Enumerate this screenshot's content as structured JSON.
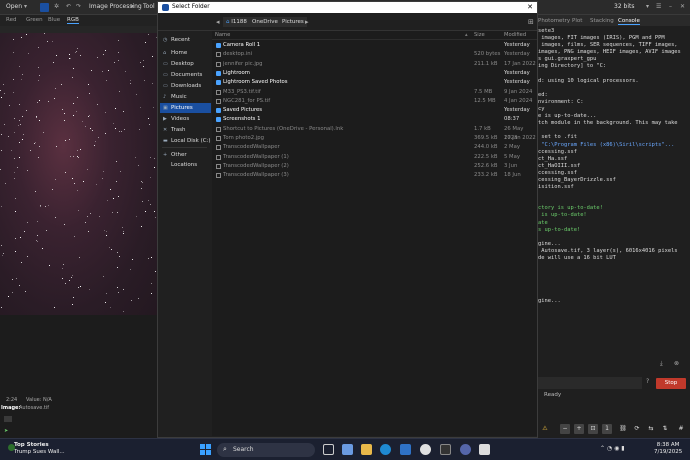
{
  "host": {
    "menu": {
      "open": "Open",
      "image_processing": "Image Processing",
      "tools": "Tool",
      "bits": "32 bits"
    },
    "channels": [
      "Red",
      "Green",
      "Blue",
      "RGB"
    ],
    "active_channel": "RGB",
    "image_label": "Image:",
    "image_name": "Autosave.tif",
    "coords": "2:24",
    "value": "Value: N/A",
    "right_tabs": [
      "Photometry",
      "Plot",
      "Stacking",
      "Console"
    ],
    "active_right_tab": "Console",
    "console_lines": [
      {
        "t": "sete3",
        "c": ""
      },
      {
        "t": " images, FIT images (IRIS), PGM and PPM",
        "c": ""
      },
      {
        "t": " images, films, SER sequences, TIFF images,",
        "c": ""
      },
      {
        "t": "images, PNG images, HEIF images, AVIF images",
        "c": ""
      },
      {
        "t": "s gui.graxpert_gpu",
        "c": ""
      },
      {
        "t": "ing Directory] to \"C:",
        "c": ""
      },
      {
        "t": "",
        "c": ""
      },
      {
        "t": "d: using 10 logical processors.",
        "c": ""
      },
      {
        "t": "",
        "c": ""
      },
      {
        "t": "ed:",
        "c": ""
      },
      {
        "t": "nvironment: C:",
        "c": ""
      },
      {
        "t": "cy",
        "c": ""
      },
      {
        "t": "e is up-to-date...",
        "c": ""
      },
      {
        "t": "tch module in the background. This may take",
        "c": ""
      },
      {
        "t": "",
        "c": ""
      },
      {
        "t": " set to .fit",
        "c": ""
      },
      {
        "t": " \"C:\\Program Files (x86)\\Siril\\scripts\"...",
        "c": "b"
      },
      {
        "t": "ccessing.ssf",
        "c": ""
      },
      {
        "t": "ct_Ha.ssf",
        "c": ""
      },
      {
        "t": "ct_HaOIII.ssf",
        "c": ""
      },
      {
        "t": "ccessing.ssf",
        "c": ""
      },
      {
        "t": "cessing_BayerDrizzle.ssf",
        "c": ""
      },
      {
        "t": "isition.ssf",
        "c": ""
      },
      {
        "t": "",
        "c": ""
      },
      {
        "t": "",
        "c": ""
      },
      {
        "t": "ctory is up-to-date!",
        "c": "g"
      },
      {
        "t": " is up-to-date!",
        "c": "g"
      },
      {
        "t": "ate",
        "c": "g"
      },
      {
        "t": "s up-to-date!",
        "c": "g"
      },
      {
        "t": "",
        "c": ""
      },
      {
        "t": "gine...",
        "c": ""
      },
      {
        "t": " Autosave.tif, 3 layer(s), 6016x4016 pixels",
        "c": ""
      },
      {
        "t": "de will use a 16 bit LUT",
        "c": ""
      },
      {
        "t": "",
        "c": ""
      },
      {
        "t": "",
        "c": ""
      },
      {
        "t": "",
        "c": ""
      },
      {
        "t": "",
        "c": ""
      },
      {
        "t": "",
        "c": ""
      },
      {
        "t": "gine...",
        "c": ""
      }
    ],
    "stop_label": "Stop",
    "status_text": "Ready"
  },
  "dialog": {
    "title": "Select Folder",
    "breadcrumb": [
      "I1188",
      "OneDrive",
      "Pictures"
    ],
    "sidebar": [
      {
        "label": "Recent",
        "icon": "clock-icon",
        "glyph": "◷"
      },
      {
        "label": "Home",
        "icon": "home-icon",
        "glyph": "⌂"
      },
      {
        "label": "Desktop",
        "icon": "folder-icon",
        "glyph": "▭"
      },
      {
        "label": "Documents",
        "icon": "folder-icon",
        "glyph": "▭"
      },
      {
        "label": "Downloads",
        "icon": "folder-icon",
        "glyph": "▭"
      },
      {
        "label": "Music",
        "icon": "music-icon",
        "glyph": "♪"
      },
      {
        "label": "Pictures",
        "icon": "pictures-icon",
        "glyph": "▣"
      },
      {
        "label": "Videos",
        "icon": "video-icon",
        "glyph": "▶"
      },
      {
        "label": "Trash",
        "icon": "trash-icon",
        "glyph": "✕"
      },
      {
        "label": "Local Disk (C:)",
        "icon": "disk-icon",
        "glyph": "▬"
      },
      {
        "label": "Other Locations",
        "icon": "plus-icon",
        "glyph": "+"
      }
    ],
    "selected_sidebar": "Pictures",
    "columns": {
      "name": "Name",
      "size": "Size",
      "modified": "Modified"
    },
    "rows": [
      {
        "name": "Camera Roll 1",
        "size": "",
        "modified": "Yesterday",
        "kind": "folder"
      },
      {
        "name": "desktop.ini",
        "size": "520 bytes",
        "modified": "Yesterday",
        "kind": "file"
      },
      {
        "name": "jennifer pic.jpg",
        "size": "211.1 kB",
        "modified": "17 Jan 2022",
        "kind": "file"
      },
      {
        "name": "Lightroom",
        "size": "",
        "modified": "Yesterday",
        "kind": "folder"
      },
      {
        "name": "Lightroom Saved Photos",
        "size": "",
        "modified": "Yesterday",
        "kind": "folder"
      },
      {
        "name": "M33_PS3.tif.tif",
        "size": "7.5 MB",
        "modified": "9 Jan 2024",
        "kind": "file"
      },
      {
        "name": "NGC281_for PS.tif",
        "size": "12.5 MB",
        "modified": "4 Jan 2024",
        "kind": "file"
      },
      {
        "name": "Saved Pictures",
        "size": "",
        "modified": "Yesterday",
        "kind": "folder"
      },
      {
        "name": "Screenshots 1",
        "size": "",
        "modified": "08:37",
        "kind": "folder"
      },
      {
        "name": "Shortcut to Pictures (OneDrive - Personal).lnk",
        "size": "1.7 kB",
        "modified": "26 May 2023",
        "kind": "file"
      },
      {
        "name": "Tom photo2.jpg",
        "size": "369.5 kB",
        "modified": "17 Jan 2022",
        "kind": "file"
      },
      {
        "name": "TranscodedWallpaper",
        "size": "244.0 kB",
        "modified": "2 May",
        "kind": "file"
      },
      {
        "name": "TranscodedWallpaper (1)",
        "size": "222.5 kB",
        "modified": "5 May",
        "kind": "file"
      },
      {
        "name": "TranscodedWallpaper (2)",
        "size": "252.6 kB",
        "modified": "3 Jun",
        "kind": "file"
      },
      {
        "name": "TranscodedWallpaper (3)",
        "size": "233.2 kB",
        "modified": "18 Jun",
        "kind": "file"
      }
    ]
  },
  "taskbar": {
    "news_title": "Top Stories",
    "news_sub": "Trump Sues Wall...",
    "search_label": "Search",
    "time": "8:38 AM",
    "date": "7/19/2025"
  },
  "colors": {
    "accent": "#1a4fa0",
    "stop": "#c0392b",
    "link": "#4aa3ff"
  }
}
